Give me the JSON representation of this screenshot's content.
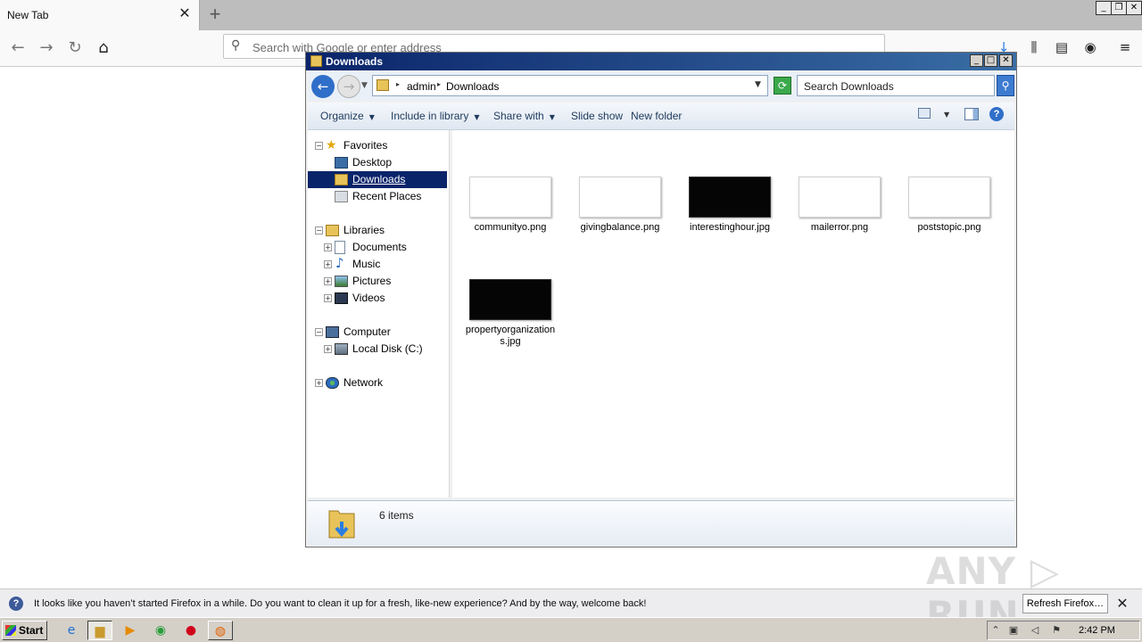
{
  "browser": {
    "tab_title": "New Tab",
    "tab_close": "✕",
    "new_tab": "+",
    "url_placeholder": "Search with Google or enter address",
    "window_buttons": [
      "_",
      "❐",
      "✕"
    ]
  },
  "explorer": {
    "title": "Downloads",
    "window_buttons": [
      "_",
      "□",
      "✕"
    ],
    "breadcrumb": [
      "admin",
      "Downloads"
    ],
    "search_placeholder": "Search Downloads",
    "commands": {
      "organize": "Organize",
      "include": "Include in library",
      "share": "Share with",
      "slideshow": "Slide show",
      "newfolder": "New folder"
    },
    "nav": {
      "favorites": "Favorites",
      "desktop": "Desktop",
      "downloads": "Downloads",
      "recent": "Recent Places",
      "libraries": "Libraries",
      "documents": "Documents",
      "music": "Music",
      "pictures": "Pictures",
      "videos": "Videos",
      "computer": "Computer",
      "localdisk": "Local Disk (C:)",
      "network": "Network"
    },
    "files": [
      {
        "name": "communityo.png",
        "dark": false
      },
      {
        "name": "givingbalance.png",
        "dark": false
      },
      {
        "name": "interestinghour.jpg",
        "dark": true
      },
      {
        "name": "mailerror.png",
        "dark": false
      },
      {
        "name": "poststopic.png",
        "dark": false
      },
      {
        "name": "propertyorganizations.jpg",
        "dark": true
      }
    ],
    "item_count": "6 items"
  },
  "notification": {
    "text": "It looks like you haven’t started Firefox in a while. Do you want to clean it up for a fresh, like-new experience? And by the way, welcome back!",
    "button": "Refresh Firefox…",
    "close": "✕"
  },
  "taskbar": {
    "start": "Start",
    "clock": "2:42 PM"
  },
  "watermark": "ANY RUN"
}
